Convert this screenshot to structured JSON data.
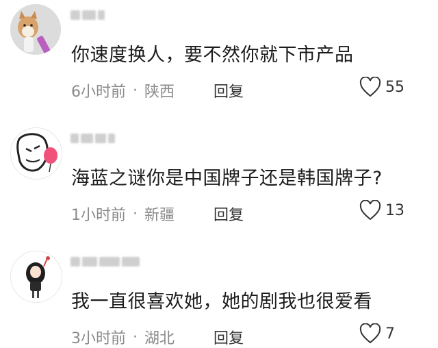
{
  "comments": [
    {
      "text": "你速度换人，要不然你就下市产品",
      "time": "6小时前",
      "location": "陕西",
      "reply_label": "回复",
      "likes": "55"
    },
    {
      "text": "海蓝之谜你是中国牌子还是韩国牌子?",
      "time": "1小时前",
      "location": "新疆",
      "reply_label": "回复",
      "likes": "13"
    },
    {
      "text": "我一直很喜欢她，她的剧我也很爱看",
      "time": "3小时前",
      "location": "湖北",
      "reply_label": "回复",
      "likes": "7"
    }
  ],
  "separator": "·",
  "icons": {
    "like": "heart-outline-icon"
  },
  "colors": {
    "text": "#1c1c1c",
    "meta": "#8a8a8a",
    "reply": "#333333"
  }
}
